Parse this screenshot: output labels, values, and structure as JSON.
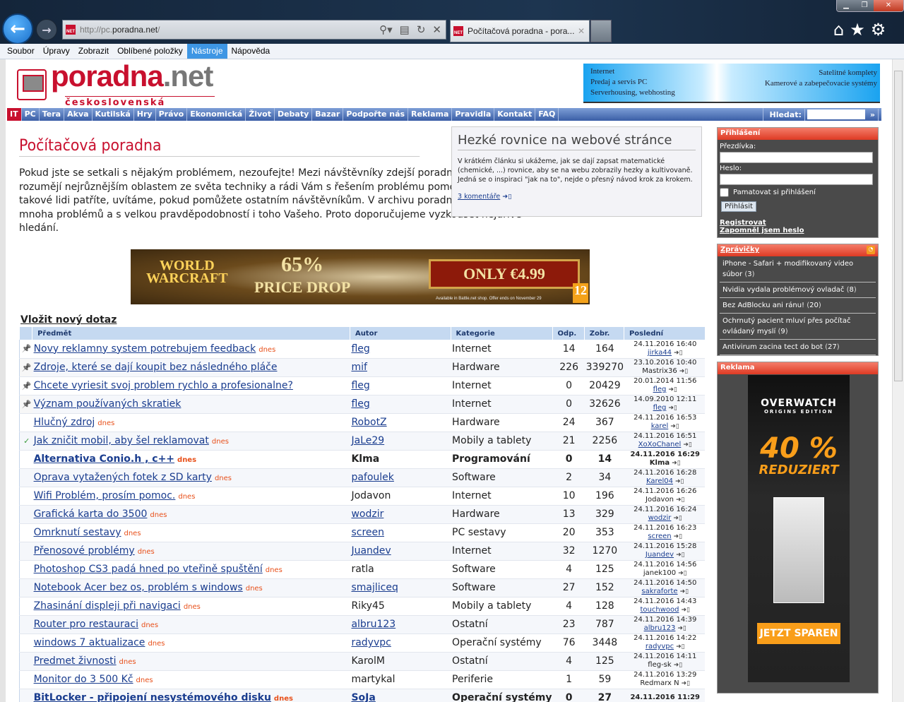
{
  "browser": {
    "url_prefix": "http://pc.",
    "url_domain": "poradna.net",
    "url_suffix": "/",
    "tab_title": "Počítačová poradna - pora...",
    "menu": [
      "Soubor",
      "Úpravy",
      "Zobrazit",
      "Oblíbené položky",
      "Nástroje",
      "Nápověda"
    ],
    "active_menu": "Nástroje"
  },
  "header": {
    "logo_name_a": "poradna",
    "logo_name_b": ".net",
    "logo_sub": "československá poradna",
    "banner_left": [
      "Internet",
      "Predaj a servis PC",
      "Serverhousing, webhosting"
    ],
    "banner_right": [
      "Satelitné komplety",
      "Kamerové a zabepečovacie systémy"
    ]
  },
  "nav": {
    "items": [
      "IT",
      "PC",
      "Tera",
      "Akva",
      "Kutilská",
      "Hry",
      "Právo",
      "Ekonomická",
      "Život",
      "Debaty",
      "Bazar",
      "Podpořte nás",
      "Reklama",
      "Pravidla",
      "Kontakt",
      "FAQ"
    ],
    "search_label": "Hledat:",
    "search_go": "»"
  },
  "main": {
    "title": "Počítačová poradna",
    "intro": "Pokud jste se setkali s nějakým problémem, nezoufejte! Mezi návštěvníky zdejší poradny je hodně lidí, kteří rozumějí nejrůznějším oblastem ze světa techniky a rádi Vám s řešením problému pomohou. A pokud mezi takové lidi patříte, uvítáme, pokud pomůžete ostatním návštěvníkům. V archivu poradny najdete řešení mnoha problémů a s velkou pravděpodobností i toho Vašeho. Proto doporučujeme vyzkoušet nejdříve hledání.",
    "new_question": "Vložit nový dotaz"
  },
  "article": {
    "title": "Hezké rovnice na webové stránce",
    "text": "V krátkém článku si ukážeme, jak se dají zapsat matematické (chemické, ...) rovnice, aby se na webu zobrazily hezky a kultivovaně. Jedná se o inspiraci \"jak na to\", nejde o přesný návod krok za krokem.",
    "comments": "3 komentáře"
  },
  "ad": {
    "brand_a": "WORLD",
    "brand_b": "WARCRAFT",
    "pct": "65%",
    "drop": "PRICE DROP",
    "price": "ONLY €4.99",
    "fine": "Available in Battle.net shop. Offer ends on November 29",
    "age": "12"
  },
  "table": {
    "headers": [
      "Předmět",
      "Autor",
      "Kategorie",
      "Odp.",
      "Zobr.",
      "Poslední"
    ],
    "dnes_label": "dnes",
    "rows": [
      {
        "icon": "pin",
        "subject": "Novy reklamny system potrebujem feedback",
        "dnes": true,
        "author": "fleg",
        "author_link": true,
        "category": "Internet",
        "odp": "14",
        "zobr": "164",
        "last_date": "24.11.2016 16:40",
        "last_user": "jirka44",
        "last_link": true
      },
      {
        "icon": "pin",
        "subject": "Zdroje, které se dají koupit bez následného pláče",
        "dnes": false,
        "author": "mif",
        "author_link": true,
        "category": "Hardware",
        "odp": "226",
        "zobr": "339270",
        "last_date": "23.10.2016 10:40",
        "last_user": "Mastrix36",
        "last_link": false
      },
      {
        "icon": "pin",
        "subject": "Chcete vyriesit svoj problem rychlo a profesionalne?",
        "dnes": false,
        "author": "fleg",
        "author_link": true,
        "category": "Internet",
        "odp": "0",
        "zobr": "20429",
        "last_date": "20.01.2014 11:56",
        "last_user": "fleg",
        "last_link": true
      },
      {
        "icon": "pin",
        "subject": "Význam používaných skratiek",
        "dnes": false,
        "author": "fleg",
        "author_link": true,
        "category": "Internet",
        "odp": "0",
        "zobr": "32626",
        "last_date": "14.09.2010 12:11",
        "last_user": "fleg",
        "last_link": true
      },
      {
        "icon": "",
        "subject": "Hlučný zdroj",
        "dnes": true,
        "author": "RobotZ",
        "author_link": true,
        "category": "Hardware",
        "odp": "24",
        "zobr": "367",
        "last_date": "24.11.2016 16:53",
        "last_user": "karel",
        "last_link": true
      },
      {
        "icon": "check",
        "subject": "Jak zničit mobil, aby šel reklamovat",
        "dnes": true,
        "author": "JaLe29",
        "author_link": true,
        "category": "Mobily a tablety",
        "odp": "21",
        "zobr": "2256",
        "last_date": "24.11.2016 16:51",
        "last_user": "XoXoChanel",
        "last_link": true
      },
      {
        "icon": "",
        "bold": true,
        "subject": "Alternativa Conio.h , c++",
        "dnes": true,
        "author": "Klma",
        "author_link": false,
        "category": "Programování",
        "odp": "0",
        "zobr": "14",
        "last_date": "24.11.2016 16:29",
        "last_user": "Klma",
        "last_link": false
      },
      {
        "icon": "",
        "subject": "Oprava vytažených fotek z SD karty",
        "dnes": true,
        "author": "pafoulek",
        "author_link": true,
        "category": "Software",
        "odp": "2",
        "zobr": "34",
        "last_date": "24.11.2016 16:28",
        "last_user": "Karel04",
        "last_link": true
      },
      {
        "icon": "",
        "subject": "Wifi Problém, prosím pomoc.",
        "dnes": true,
        "author": "Jodavon",
        "author_link": false,
        "category": "Internet",
        "odp": "10",
        "zobr": "196",
        "last_date": "24.11.2016 16:26",
        "last_user": "Jodavon",
        "last_link": false
      },
      {
        "icon": "",
        "subject": "Grafická karta do 3500",
        "dnes": true,
        "author": "wodzir",
        "author_link": true,
        "category": "Hardware",
        "odp": "13",
        "zobr": "329",
        "last_date": "24.11.2016 16:24",
        "last_user": "wodzir",
        "last_link": true
      },
      {
        "icon": "",
        "subject": "Omrknutí sestavy",
        "dnes": true,
        "author": "screen",
        "author_link": true,
        "category": "PC sestavy",
        "odp": "20",
        "zobr": "353",
        "last_date": "24.11.2016 16:23",
        "last_user": "screen",
        "last_link": true
      },
      {
        "icon": "",
        "subject": "Přenosové problémy",
        "dnes": true,
        "author": "Juandev",
        "author_link": true,
        "category": "Internet",
        "odp": "32",
        "zobr": "1270",
        "last_date": "24.11.2016 15:28",
        "last_user": "Juandev",
        "last_link": true
      },
      {
        "icon": "",
        "subject": "Photoshop CS3 padá hned po vteřině spuštění",
        "dnes": true,
        "author": "ratla",
        "author_link": false,
        "category": "Software",
        "odp": "4",
        "zobr": "125",
        "last_date": "24.11.2016 14:56",
        "last_user": "janek100",
        "last_link": false
      },
      {
        "icon": "",
        "subject": "Notebook Acer bez os, problém s windows",
        "dnes": true,
        "author": "smajliceq",
        "author_link": true,
        "category": "Software",
        "odp": "27",
        "zobr": "152",
        "last_date": "24.11.2016 14:50",
        "last_user": "sakraforte",
        "last_link": true
      },
      {
        "icon": "",
        "subject": "Zhasinání displeji při navigaci",
        "dnes": true,
        "author": "Riky45",
        "author_link": false,
        "category": "Mobily a tablety",
        "odp": "4",
        "zobr": "128",
        "last_date": "24.11.2016 14:43",
        "last_user": "touchwood",
        "last_link": true
      },
      {
        "icon": "",
        "subject": "Router pro restauraci",
        "dnes": true,
        "author": "albru123",
        "author_link": true,
        "category": "Ostatní",
        "odp": "23",
        "zobr": "787",
        "last_date": "24.11.2016 14:39",
        "last_user": "albru123",
        "last_link": true
      },
      {
        "icon": "",
        "subject": "windows 7 aktualizace",
        "dnes": true,
        "author": "radyvpc",
        "author_link": true,
        "category": "Operační systémy",
        "odp": "76",
        "zobr": "3448",
        "last_date": "24.11.2016 14:22",
        "last_user": "radyvpc",
        "last_link": true
      },
      {
        "icon": "",
        "subject": "Predmet živnosti",
        "dnes": true,
        "author": "KarolM",
        "author_link": false,
        "category": "Ostatní",
        "odp": "4",
        "zobr": "125",
        "last_date": "24.11.2016 14:11",
        "last_user": "fleg-sk",
        "last_link": false
      },
      {
        "icon": "",
        "subject": "Monitor do 3 500 Kč",
        "dnes": true,
        "author": "martykal",
        "author_link": false,
        "category": "Periferie",
        "odp": "1",
        "zobr": "59",
        "last_date": "24.11.2016 13:29",
        "last_user": "Redmarx N",
        "last_link": false
      },
      {
        "icon": "",
        "bold": true,
        "subject": "BitLocker - připojení nesystémového disku",
        "dnes": true,
        "author": "SoJa",
        "author_link": true,
        "category": "Operační systémy",
        "odp": "0",
        "zobr": "27",
        "last_date": "24.11.2016 11:29",
        "last_user": "",
        "last_link": false
      }
    ]
  },
  "sidebar": {
    "login": {
      "title": "Přihlášení",
      "nick_label": "Přezdívka:",
      "pass_label": "Heslo:",
      "remember": "Pamatovat si přihlášení",
      "submit": "Přihlásit",
      "register": "Registrovat",
      "forgot": "Zapomněl jsem heslo"
    },
    "news": {
      "title": "Zprávičky",
      "items": [
        {
          "t": "iPhone - Safari + modifikovaný video súbor",
          "c": "3"
        },
        {
          "t": "Nvidia vydala problémový ovladač",
          "c": "8"
        },
        {
          "t": "Bez AdBlocku ani ránu!",
          "c": "20"
        },
        {
          "t": "Ochrnutý pacient mluví přes počítač ovládaný myslí",
          "c": "9"
        },
        {
          "t": "Antivirum zacina tect do bot",
          "c": "27"
        }
      ]
    },
    "ad": {
      "title": "Reklama",
      "brand": "OVERWATCH",
      "edition": "ORIGINS EDITION",
      "pct": "40 %",
      "reduziert": "REDUZIERT",
      "cta": "JETZT SPAREN"
    }
  }
}
